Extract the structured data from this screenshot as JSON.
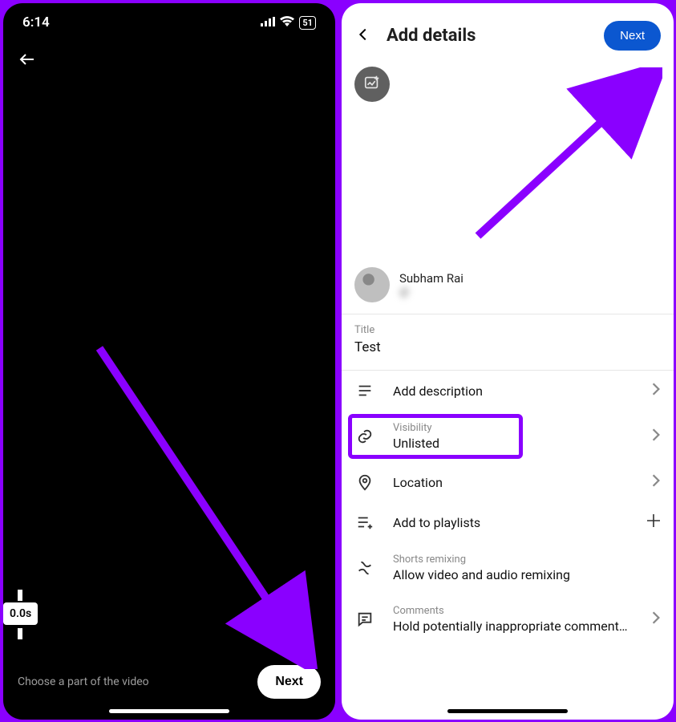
{
  "left": {
    "status": {
      "time": "6:14",
      "battery": "51"
    },
    "timecode": "0.0s",
    "hint": "Choose a part of the video",
    "next": "Next"
  },
  "right": {
    "header": {
      "title": "Add details",
      "next": "Next"
    },
    "profile": {
      "name": "Subham Rai",
      "handle": "@"
    },
    "title": {
      "label": "Title",
      "value": "Test"
    },
    "options": {
      "description": "Add description",
      "visibility": {
        "label": "Visibility",
        "value": "Unlisted"
      },
      "location": "Location",
      "playlists": "Add to playlists",
      "remix": {
        "label": "Shorts remixing",
        "value": "Allow video and audio remixing"
      },
      "comments": {
        "label": "Comments",
        "value": "Hold potentially inappropriate comments f…"
      }
    }
  }
}
